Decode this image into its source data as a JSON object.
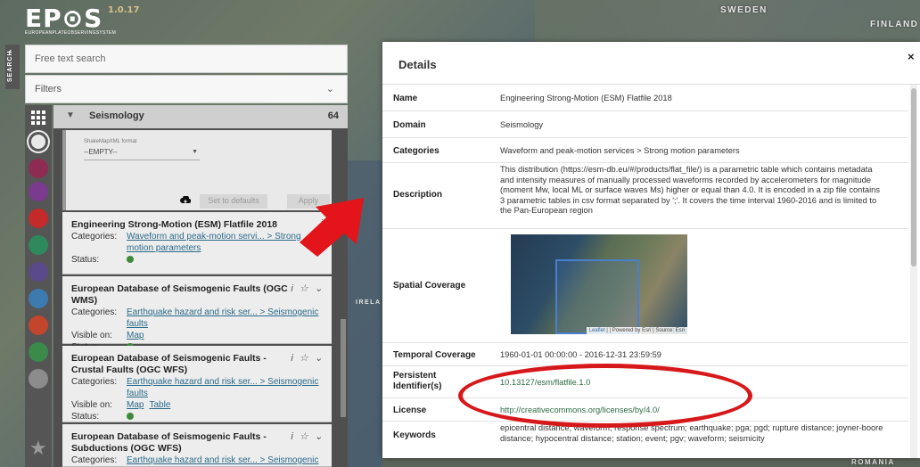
{
  "app": {
    "logo": "EP⊙S",
    "version": "1.0.17",
    "subtitle": "EUROPEANPLATEOBSERVINGSYSTEM"
  },
  "map_labels": {
    "sweden": "SWEDEN",
    "finland": "FINLAND",
    "ireland": "IRELA",
    "romania": "ROMANIA"
  },
  "side_tab": {
    "label": "SEARCH",
    "chevron": "‹"
  },
  "search": {
    "placeholder": "Free text search",
    "filters_label": "Filters",
    "filters_chevron": "⌄"
  },
  "domain_header": {
    "name": "Seismology",
    "count": "64"
  },
  "filter_box": {
    "format_label": "ShakeMapXML format",
    "select_value": "--EMPTY--",
    "btn_defaults": "Set to defaults",
    "btn_apply": "Apply"
  },
  "datasets": [
    {
      "title": "Engineering Strong-Motion (ESM) Flatfile 2018",
      "categories_key": "Categories:",
      "categories_value": "Waveform and peak-motion servi... > Strong motion parameters",
      "status_key": "Status:",
      "actions": "i"
    },
    {
      "title": "European Database of Seismogenic Faults (OGC WMS)",
      "categories_key": "Categories:",
      "categories_value": "Earthquake hazard and risk ser... > Seismogenic faults",
      "visible_key": "Visible on:",
      "visible_value": "Map",
      "status_key": "Status:",
      "actions": "i ☆ ⌄"
    },
    {
      "title": "European Database of Seismogenic Faults - Crustal Faults (OGC WFS)",
      "categories_key": "Categories:",
      "categories_value": "Earthquake hazard and risk ser... > Seismogenic faults",
      "visible_key": "Visible on:",
      "visible_value": "Map",
      "visible_value2": "Table",
      "status_key": "Status:",
      "actions": "i ☆ ⌄"
    },
    {
      "title": "European Database of Seismogenic Faults - Subductions (OGC WFS)",
      "categories_key": "Categories:",
      "categories_value": "Earthquake hazard and risk ser... > Seismogenic faults",
      "actions": "i ☆ ⌄"
    }
  ],
  "details": {
    "title": "Details",
    "close": "×",
    "rows": {
      "name": {
        "key": "Name",
        "value": "Engineering Strong-Motion (ESM) Flatfile 2018"
      },
      "domain": {
        "key": "Domain",
        "value": "Seismology"
      },
      "categories": {
        "key": "Categories",
        "value": "Waveform and peak-motion services > Strong motion parameters"
      },
      "description": {
        "key": "Description",
        "value": "This distribution (https://esm-db.eu/#/products/flat_file/) is a parametric table which contains metadata and intensity measures of manually processed waveforms recorded by accelerometers for magnitude (moment Mw, local ML or surface waves Ms) higher or equal than 4.0. It is encoded in a zip file contains 3 parametric tables in csv format separated by ';'. It covers the time interval 1960-2016 and is limited to the Pan-European region"
      },
      "spatial": {
        "key": "Spatial Coverage",
        "attribution_leaflet": "Leaflet",
        "attribution_rest": " | | Powered by Esri | Source: Esri"
      },
      "temporal": {
        "key": "Temporal Coverage",
        "value": "1960-01-01 00:00:00 - 2016-12-31 23:59:59"
      },
      "pid": {
        "key": "Persistent Identifier(s)",
        "value": "10.13127/esm/flatfile.1.0"
      },
      "license": {
        "key": "License",
        "value": "http://creativecommons.org/licenses/by/4.0/"
      },
      "keywords": {
        "key": "Keywords",
        "value": "epicentral distance; waveform; response spectrum; earthquake; pga; pgd; rupture distance; joyner-boore distance; hypocentral distance; station; event; pgv; waveform; seismicity"
      }
    }
  },
  "colors": {
    "link": "#2b6a8a",
    "license_link": "#2d6a46",
    "annotation": "#d7181b",
    "status_ok": "#3f8a3a"
  }
}
